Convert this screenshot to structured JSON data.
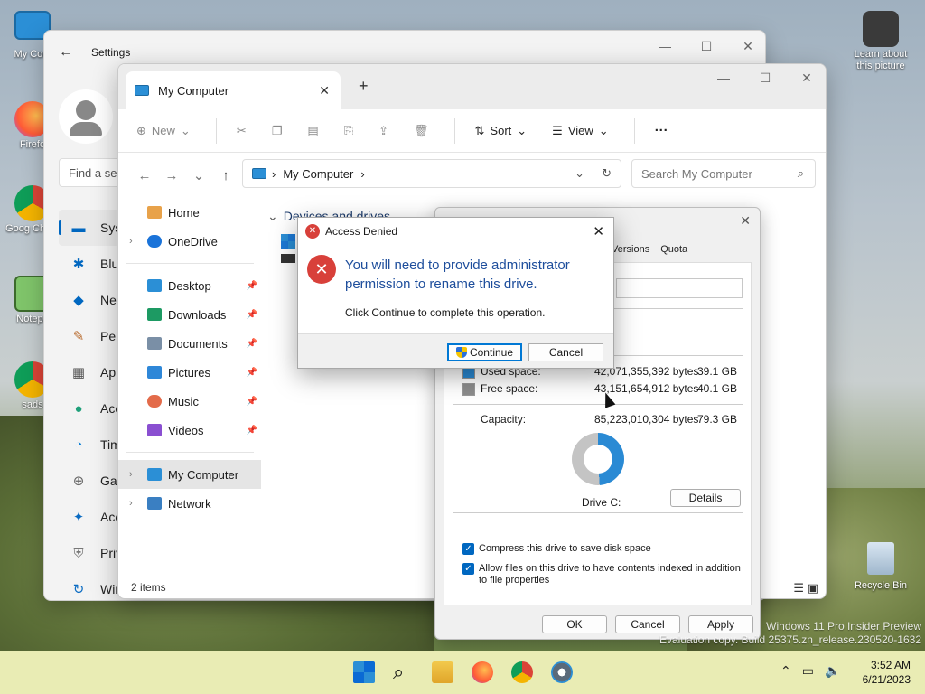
{
  "desktop": {
    "icons": [
      {
        "label": "My Com"
      },
      {
        "label": "Firefo"
      },
      {
        "label": "Goog Chron"
      },
      {
        "label": "Notepa"
      },
      {
        "label": "sads"
      },
      {
        "label": "Learn about this picture"
      },
      {
        "label": "Recycle Bin"
      }
    ],
    "watermark_line1": "Windows 11 Pro Insider Preview",
    "watermark_line2": "Evaluation copy. Build 25375.zn_release.230520-1632"
  },
  "settings": {
    "title": "Settings",
    "search_placeholder": "Find a se",
    "nav": [
      {
        "label": "Syst",
        "icon": "monitor-icon"
      },
      {
        "label": "Blue",
        "icon": "bluetooth-icon"
      },
      {
        "label": "Net",
        "icon": "wifi-icon"
      },
      {
        "label": "Pers",
        "icon": "brush-icon"
      },
      {
        "label": "App",
        "icon": "apps-icon"
      },
      {
        "label": "Acc",
        "icon": "person-icon"
      },
      {
        "label": "Tim",
        "icon": "clock-icon"
      },
      {
        "label": "Gar",
        "icon": "gamepad-icon"
      },
      {
        "label": "Acc",
        "icon": "accessibility-icon"
      },
      {
        "label": "Priv",
        "icon": "shield-icon"
      },
      {
        "label": "Win",
        "icon": "update-icon"
      }
    ]
  },
  "explorer": {
    "tab_title": "My Computer",
    "toolbar": {
      "new": "New",
      "sort": "Sort",
      "view": "View",
      "more": "···"
    },
    "address": "My Computer",
    "search_placeholder": "Search My Computer",
    "nav": {
      "home": "Home",
      "onedrive": "OneDrive",
      "quick": [
        "Desktop",
        "Downloads",
        "Documents",
        "Pictures",
        "Music",
        "Videos"
      ],
      "my_computer": "My Computer",
      "network": "Network"
    },
    "section_title": "Devices and drives",
    "status": "2 items"
  },
  "properties": {
    "tabs": [
      "Versions",
      "Quota"
    ],
    "used_label": "Used space:",
    "used_bytes": "42,071,355,392 bytes",
    "used_gb": "39.1 GB",
    "free_label": "Free space:",
    "free_bytes": "43,151,654,912 bytes",
    "free_gb": "40.1 GB",
    "capacity_label": "Capacity:",
    "capacity_bytes": "85,223,010,304 bytes",
    "capacity_gb": "79.3 GB",
    "drive_label": "Drive C:",
    "details": "Details",
    "compress": "Compress this drive to save disk space",
    "index": "Allow files on this drive to have contents indexed in addition to file properties",
    "ok": "OK",
    "cancel": "Cancel",
    "apply": "Apply",
    "colors": {
      "used": "#2a8ad4",
      "free": "#c4c4c4"
    }
  },
  "dialog": {
    "title": "Access Denied",
    "message": "You will need to provide administrator permission to rename this drive.",
    "sub": "Click Continue to complete this operation.",
    "continue": "Continue",
    "cancel": "Cancel"
  },
  "taskbar": {
    "time": "3:52 AM",
    "date": "6/21/2023"
  }
}
